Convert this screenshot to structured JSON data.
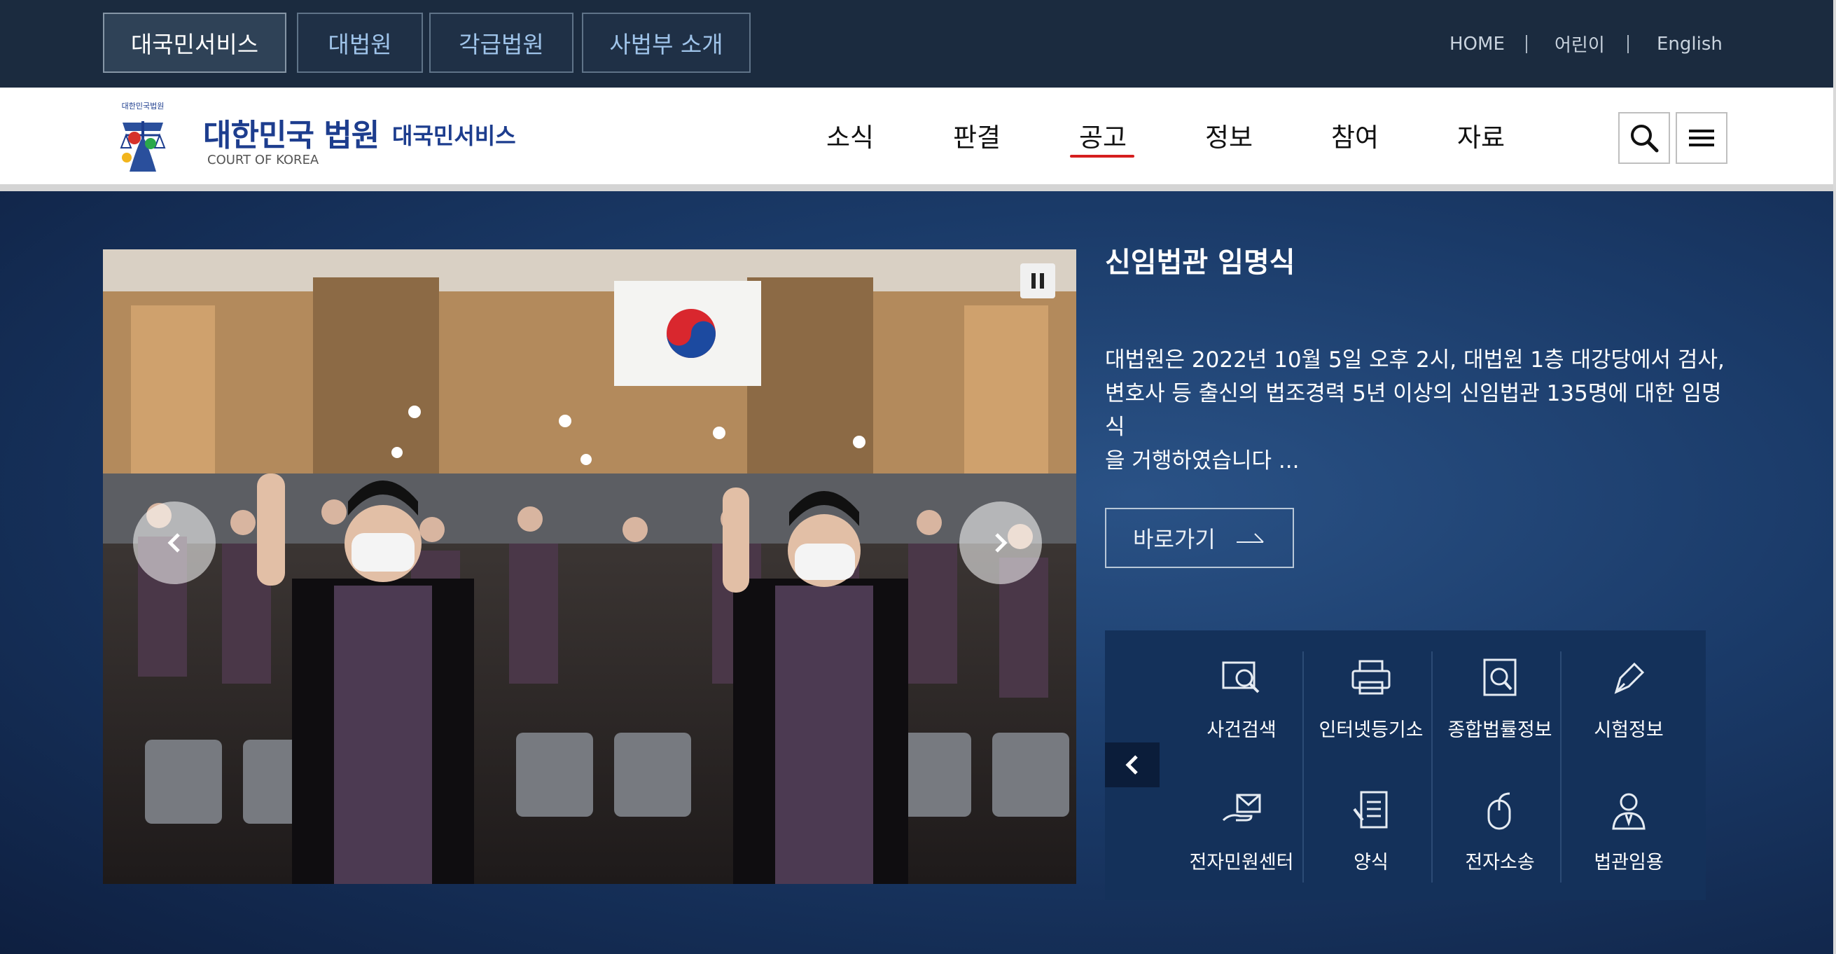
{
  "top_tabs": [
    {
      "label": "대국민서비스",
      "active": true
    },
    {
      "label": "대법원",
      "active": false
    },
    {
      "label": "각급법원",
      "active": false
    },
    {
      "label": "사법부 소개",
      "active": false
    }
  ],
  "utility_links": [
    "HOME",
    "어린이",
    "English"
  ],
  "logo": {
    "emblem_text": "대한민국법원",
    "name": "대한민국 법원",
    "english": "COURT OF KOREA",
    "service": "대국민서비스"
  },
  "gnb": {
    "items": [
      "소식",
      "판결",
      "공고",
      "정보",
      "참여",
      "자료"
    ],
    "active": "공고"
  },
  "header_buttons": {
    "search": "search-icon",
    "menu": "menu-icon"
  },
  "hero": {
    "title": "신임법관 임명식",
    "body_lines": [
      "대법원은 2022년 10월 5일 오후 2시, 대법원 1층 대강당에서 검사,",
      "변호사 등 출신의 법조경력 5년 이상의 신임법관 135명에 대한 임명식",
      "을 거행하였습니다 ..."
    ],
    "go_label": "바로가기"
  },
  "quick_menu": [
    {
      "label": "사건검색",
      "icon": "case-search-icon"
    },
    {
      "label": "인터넷등기소",
      "icon": "printer-icon"
    },
    {
      "label": "종합법률정보",
      "icon": "document-search-icon"
    },
    {
      "label": "시험정보",
      "icon": "pen-icon"
    },
    {
      "label": "전자민원센터",
      "icon": "hand-envelope-icon"
    },
    {
      "label": "양식",
      "icon": "form-document-icon"
    },
    {
      "label": "전자소송",
      "icon": "mouse-icon"
    },
    {
      "label": "법관임용",
      "icon": "judge-person-icon"
    }
  ],
  "colors": {
    "topbar": "#1b2b3f",
    "brand_blue": "#1d3d8e",
    "active_underline": "#d51e1e",
    "quick_panel": "#14315a"
  }
}
